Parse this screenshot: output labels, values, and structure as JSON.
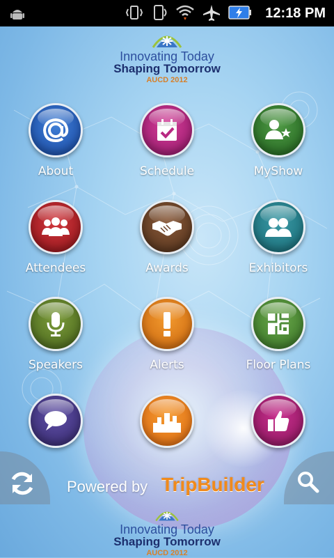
{
  "status_bar": {
    "time": "12:18 PM"
  },
  "header": {
    "line1": "Innovating Today",
    "line2": "Shaping Tomorrow",
    "line3": "AUCD 2012"
  },
  "grid": [
    {
      "label": "About",
      "icon": "at-sign-icon",
      "color": "#2a5fbf"
    },
    {
      "label": "Schedule",
      "icon": "calendar-icon",
      "color": "#b82a82"
    },
    {
      "label": "MyShow",
      "icon": "user-star-icon",
      "color": "#3a7d33"
    },
    {
      "label": "Attendees",
      "icon": "group-icon",
      "color": "#b0232b"
    },
    {
      "label": "Awards",
      "icon": "handshake-icon",
      "color": "#6b4127"
    },
    {
      "label": "Exhibitors",
      "icon": "two-people-icon",
      "color": "#2a818c"
    },
    {
      "label": "Speakers",
      "icon": "microphone-icon",
      "color": "#5f7e2a"
    },
    {
      "label": "Alerts",
      "icon": "exclamation-icon",
      "color": "#e07e1c"
    },
    {
      "label": "Floor Plans",
      "icon": "floor-plan-icon",
      "color": "#4f8d39"
    },
    {
      "label": "",
      "icon": "speech-bubble-icon",
      "color": "#4a3d8c"
    },
    {
      "label": "",
      "icon": "city-skyline-icon",
      "color": "#ec7d1f"
    },
    {
      "label": "",
      "icon": "thumbs-up-icon",
      "color": "#a82377"
    }
  ],
  "footer": {
    "powered_by": "Powered by",
    "brand": "TripBuilder"
  }
}
